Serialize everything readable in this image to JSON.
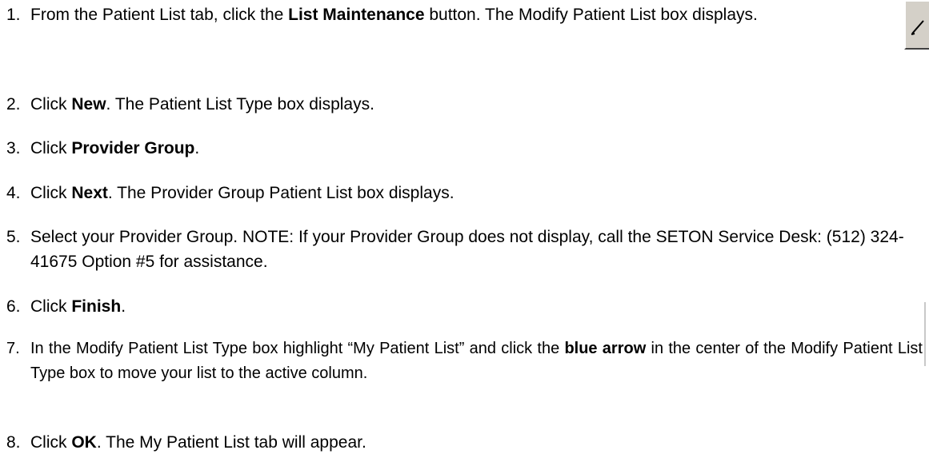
{
  "steps": [
    {
      "number": "1.",
      "parts": [
        "From the Patient List tab, click the ",
        "List Maintenance",
        " button. The Modify Patient List box displays."
      ]
    },
    {
      "number": "2.",
      "parts": [
        "Click ",
        "New",
        ". The Patient List Type box displays."
      ]
    },
    {
      "number": "3.",
      "parts": [
        "Click ",
        "Provider Group",
        "."
      ]
    },
    {
      "number": "4.",
      "parts": [
        "Click ",
        "Next",
        ". The Provider Group Patient List box displays."
      ]
    },
    {
      "number": "5.",
      "parts": [
        "Select your Provider Group. NOTE: If your Provider Group does not display, call the SETON Service Desk: (512) 324-41675 Option #5 for assistance."
      ]
    },
    {
      "number": "6.",
      "parts": [
        "Click ",
        "Finish",
        "."
      ]
    },
    {
      "number": "7.",
      "parts": [
        "In the Modify Patient List Type box highlight “My Patient List” and click the ",
        "blue arrow",
        " in the center of the Modify Patient List Type box to move your list to the active column."
      ]
    },
    {
      "number": "8.",
      "parts": [
        "Click ",
        "OK",
        ". The My Patient List tab will appear."
      ]
    }
  ],
  "icons": {
    "list_maintenance_button": "list-maintenance-icon"
  }
}
